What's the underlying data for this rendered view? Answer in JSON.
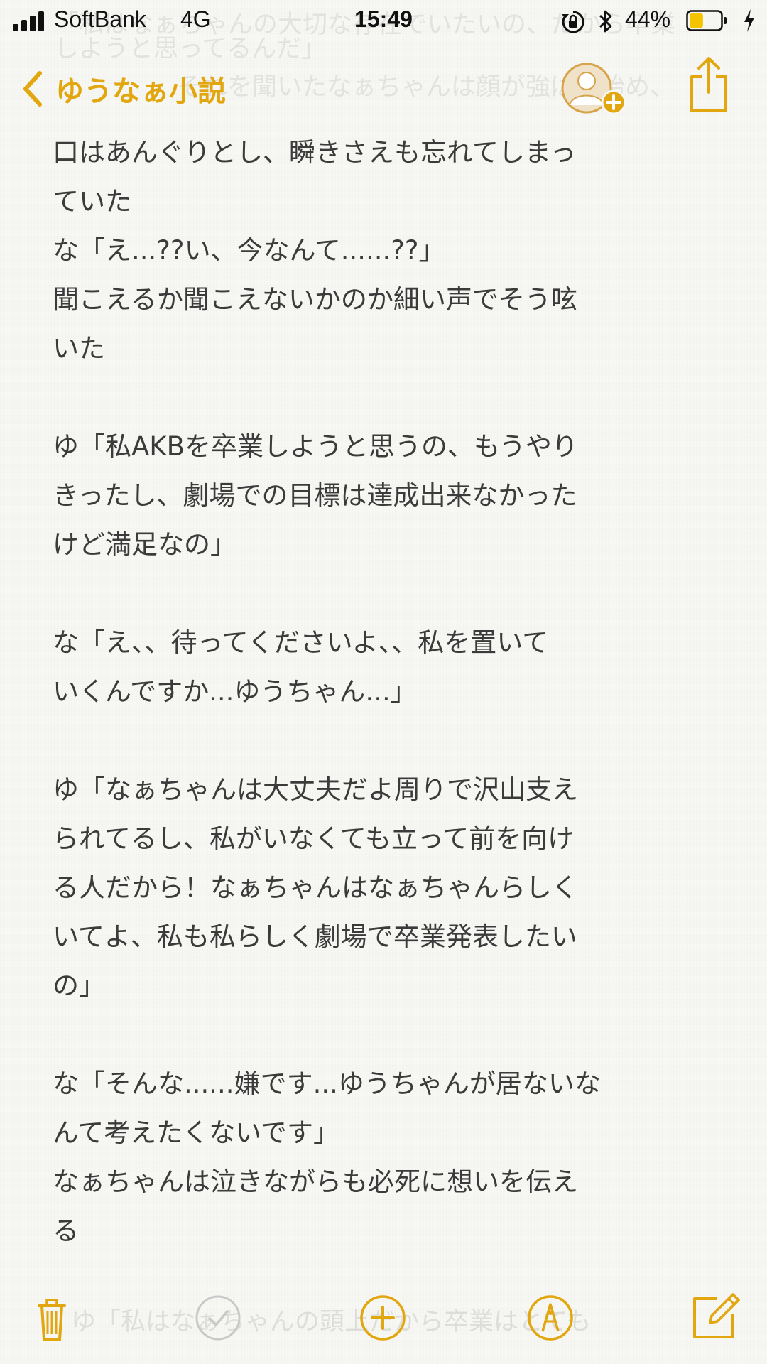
{
  "status_bar": {
    "carrier": "SoftBank",
    "network": "4G",
    "time": "15:49",
    "battery_percent": "44%",
    "battery_level": 0.44,
    "icons": [
      "signal-icon",
      "orientation-lock-icon",
      "bluetooth-icon",
      "battery-icon",
      "charging-icon"
    ]
  },
  "nav": {
    "back_label": "ゆうなぁ小説",
    "icons": [
      "chevron-left-icon",
      "add-people-icon",
      "share-icon"
    ]
  },
  "ghost_text": {
    "line1": "「私はなぁちゃんの大切な存在でいたいの、だから卒業",
    "line2": "しようと思ってるんだ」",
    "line3": "それを聞いたなぁちゃんは顔が強ばり始め、",
    "bottom": "ゆ「私はなぁちゃんの頭上だから卒業はとても"
  },
  "note": {
    "lines": [
      "口はあんぐりとし、瞬きさえも忘れてしまっ",
      "ていた",
      "な「え...??い、今なんて......??」",
      "聞こえるか聞こえないかのか細い声でそう呟",
      "いた",
      "",
      "ゆ「私AKBを卒業しようと思うの、もうやり",
      "きったし、劇場での目標は達成出来なかった",
      "けど満足なの」",
      "",
      "な「え、、待ってくださいよ、、私を置いて",
      "いくんですか...ゆうちゃん...」",
      "",
      "ゆ「なぁちゃんは大丈夫だよ周りで沢山支え",
      "られてるし、私がいなくても立って前を向け",
      "る人だから！なぁちゃんはなぁちゃんらしく",
      "いてよ、私も私らしく劇場で卒業発表したい",
      "の」",
      "",
      "な「そんな......嫌です...ゆうちゃんが居ないな",
      "んて考えたくないです」",
      "なぁちゃんは泣きながらも必死に想いを伝え",
      "る"
    ]
  },
  "toolbar": {
    "icons": [
      "trash-icon",
      "checklist-icon",
      "add-icon",
      "markup-icon",
      "compose-icon"
    ]
  },
  "colors": {
    "accent": "#e2a60e",
    "text": "#3b3b3b",
    "background": "#f7f7f4"
  }
}
